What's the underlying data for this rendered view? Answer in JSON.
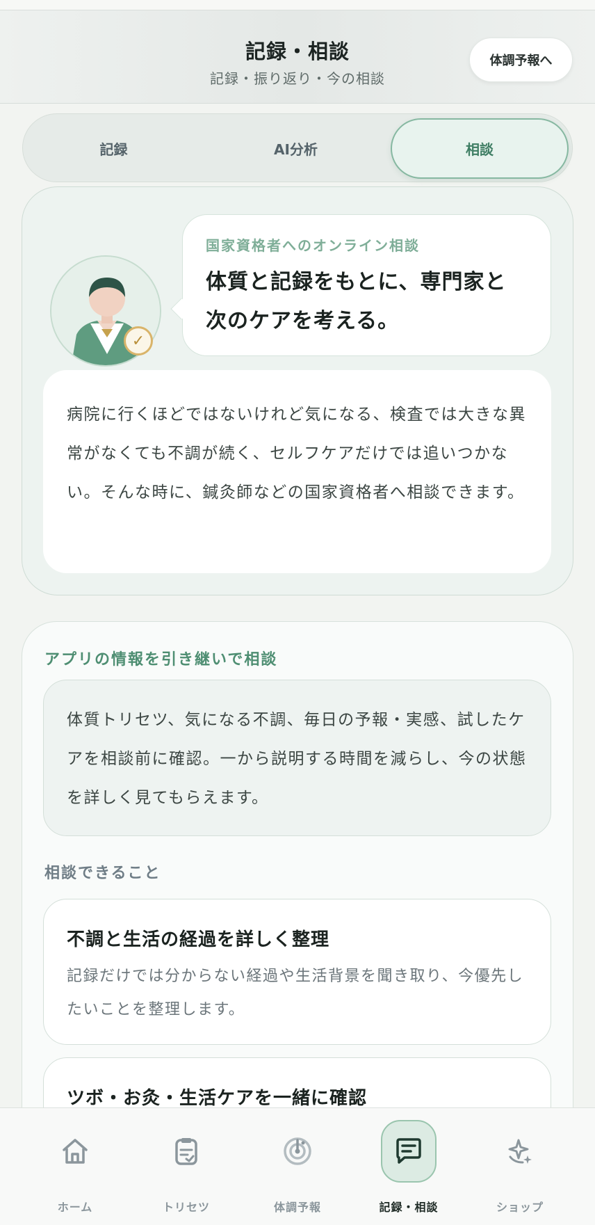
{
  "header": {
    "title": "記録・相談",
    "subtitle": "記録・振り返り・今の相談",
    "forecast_button": "体調予報へ"
  },
  "segments": [
    {
      "label": "記録",
      "active": false
    },
    {
      "label": "AI分析",
      "active": false
    },
    {
      "label": "相談",
      "active": true
    }
  ],
  "intro": {
    "kicker": "国家資格者へのオンライン相談",
    "headline_line1": "体質と記録をもとに、専門家と",
    "headline_line2": "次のケアを考える。",
    "body": "病院に行くほどではないけれど気になる、検査では大きな異常がなくても不調が続く、セルフケアだけでは追いつかない。そんな時に、鍼灸師などの国家資格者へ相談できます。"
  },
  "handover": {
    "label": "アプリの情報を引き継いで相談",
    "body": "体質トリセツ、気になる不調、毎日の予報・実感、試したケアを相談前に確認。一から説明する時間を減らし、今の状態を詳しく見てもらえます。"
  },
  "consult_items": {
    "label": "相談できること",
    "items": [
      {
        "title": "不調と生活の経過を詳しく整理",
        "desc": "記録だけでは分からない経過や生活背景を聞き取り、今優先したいことを整理します。"
      },
      {
        "title": "ツボ・お灸・生活ケアを一緒に確認",
        "desc": ""
      }
    ]
  },
  "tabbar": [
    {
      "label": "ホーム",
      "icon": "home-icon",
      "active": false
    },
    {
      "label": "トリセツ",
      "icon": "clipboard-icon",
      "active": false
    },
    {
      "label": "体調予報",
      "icon": "radar-icon",
      "active": false
    },
    {
      "label": "記録・相談",
      "icon": "chat-icon",
      "active": true
    },
    {
      "label": "ショップ",
      "icon": "sparkle-icon",
      "active": false
    }
  ],
  "colors": {
    "accent": "#4e8e72",
    "accent_light": "#e8f3ee",
    "background": "#f2f4f1"
  }
}
